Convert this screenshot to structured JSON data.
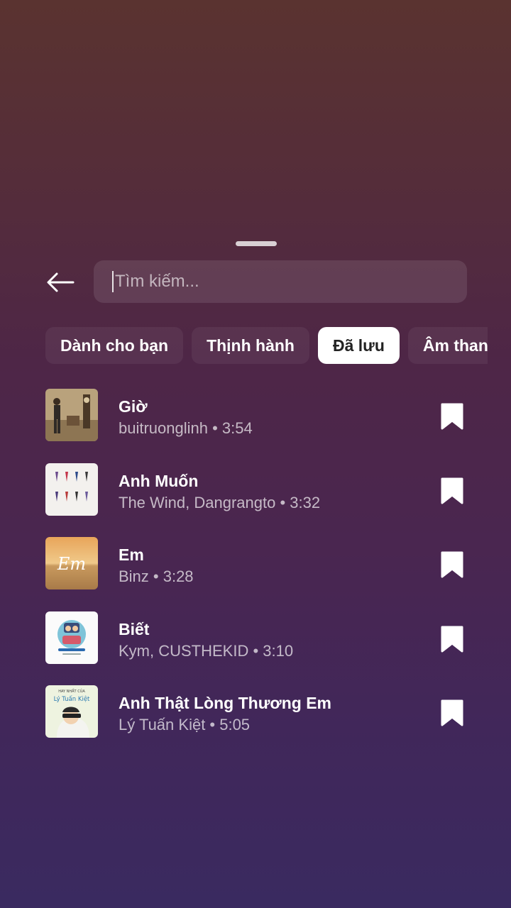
{
  "search": {
    "placeholder": "Tìm kiếm..."
  },
  "tabs": [
    {
      "label": "Dành cho bạn",
      "active": false
    },
    {
      "label": "Thịnh hành",
      "active": false
    },
    {
      "label": "Đã lưu",
      "active": true
    },
    {
      "label": "Âm thanh gốc",
      "active": false
    }
  ],
  "tracks": [
    {
      "title": "Giờ",
      "artist": "buitruonglinh",
      "duration": "3:54",
      "subtitle": "buitruonglinh • 3:54",
      "saved": true
    },
    {
      "title": "Anh Muốn",
      "artist": "The Wind, Dangrangto",
      "duration": "3:32",
      "subtitle": "The Wind, Dangrangto • 3:32",
      "saved": true
    },
    {
      "title": "Em",
      "artist": "Binz",
      "duration": "3:28",
      "subtitle": "Binz • 3:28",
      "saved": true
    },
    {
      "title": "Biết",
      "artist": "Kym, CUSTHEKID",
      "duration": "3:10",
      "subtitle": "Kym, CUSTHEKID • 3:10",
      "saved": true
    },
    {
      "title": "Anh Thật Lòng Thương Em",
      "artist": "Lý Tuấn Kiệt",
      "duration": "5:05",
      "subtitle": "Lý Tuấn Kiệt • 5:05",
      "saved": true
    }
  ],
  "album_art_text": {
    "em": "Em",
    "lytuankiet_header": "HAY NHẤT CỦA",
    "lytuankiet_name": "Lý Tuấn Kiệt"
  },
  "colors": {
    "active_tab_bg": "#ffffff",
    "active_tab_text": "#222222",
    "icon": "#ffffff"
  }
}
